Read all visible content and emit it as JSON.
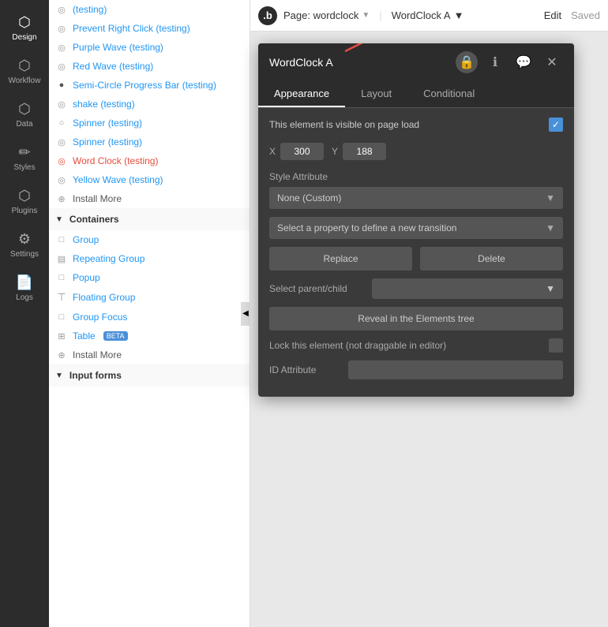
{
  "topbar": {
    "logo": ".b",
    "page_label": "Page: wordclock",
    "wordclock_label": "WordClock A",
    "edit_label": "Edit",
    "saved_label": "Saved"
  },
  "sidebar": {
    "items": [
      {
        "id": "design",
        "label": "Design",
        "icon": "⬡",
        "active": true
      },
      {
        "id": "workflow",
        "label": "Workflow",
        "icon": "⬡"
      },
      {
        "id": "data",
        "label": "Data",
        "icon": "⬡"
      },
      {
        "id": "styles",
        "label": "Styles",
        "icon": "✏"
      },
      {
        "id": "plugins",
        "label": "Plugins",
        "icon": "⬡"
      },
      {
        "id": "settings",
        "label": "Settings",
        "icon": "⚙"
      },
      {
        "id": "logs",
        "label": "Logs",
        "icon": "⬡"
      }
    ]
  },
  "element_list": {
    "items": [
      {
        "id": "testing1",
        "label": "(testing)",
        "icon": "◎",
        "type": "radio"
      },
      {
        "id": "prevent-right",
        "label": "Prevent Right Click (testing)",
        "icon": "◎",
        "type": "radio"
      },
      {
        "id": "purple-wave",
        "label": "Purple Wave (testing)",
        "icon": "◎",
        "type": "radio"
      },
      {
        "id": "red-wave",
        "label": "Red Wave (testing)",
        "icon": "◎",
        "type": "radio"
      },
      {
        "id": "semi-circle",
        "label": "Semi-Circle Progress Bar (testing)",
        "icon": "●",
        "type": "dot"
      },
      {
        "id": "shake",
        "label": "shake (testing)",
        "icon": "◎",
        "type": "radio"
      },
      {
        "id": "spinner1",
        "label": "Spinner (testing)",
        "icon": "○",
        "type": "circle"
      },
      {
        "id": "spinner2",
        "label": "Spinner (testing)",
        "icon": "◎",
        "type": "radio"
      },
      {
        "id": "word-clock",
        "label": "Word Clock (testing)",
        "icon": "◎",
        "type": "radio",
        "highlighted": true
      },
      {
        "id": "yellow-wave",
        "label": "Yellow Wave (testing)",
        "icon": "◎",
        "type": "radio"
      },
      {
        "id": "install-more1",
        "label": "Install More",
        "icon": "⊕",
        "type": "install"
      },
      {
        "id": "containers-header",
        "label": "Containers",
        "icon": "▼",
        "type": "header"
      },
      {
        "id": "group",
        "label": "Group",
        "icon": "□",
        "type": "container"
      },
      {
        "id": "repeating-group",
        "label": "Repeating Group",
        "icon": "▤",
        "type": "container"
      },
      {
        "id": "popup",
        "label": "Popup",
        "icon": "□",
        "type": "container"
      },
      {
        "id": "floating-group",
        "label": "Floating Group",
        "icon": "⊤",
        "type": "container"
      },
      {
        "id": "group-focus",
        "label": "Group Focus",
        "icon": "□",
        "type": "container"
      },
      {
        "id": "table",
        "label": "Table",
        "icon": "⊞",
        "type": "container",
        "badge": "BETA"
      },
      {
        "id": "install-more2",
        "label": "Install More",
        "icon": "⊕",
        "type": "install"
      },
      {
        "id": "input-forms-header",
        "label": "Input forms",
        "icon": "▼",
        "type": "header"
      }
    ]
  },
  "panel": {
    "title": "WordClock A",
    "tabs": [
      "Appearance",
      "Layout",
      "Conditional"
    ],
    "active_tab": "Appearance",
    "visible_label": "This element is visible on page load",
    "x_label": "X",
    "x_value": "300",
    "y_label": "Y",
    "y_value": "188",
    "style_attribute_label": "Style Attribute",
    "style_attribute_value": "None (Custom)",
    "transition_placeholder": "Select a property to define a new transition",
    "replace_label": "Replace",
    "delete_label": "Delete",
    "parent_child_label": "Select parent/child",
    "reveal_label": "Reveal in the Elements tree",
    "lock_label": "Lock this element (not draggable in editor)",
    "id_attribute_label": "ID Attribute"
  }
}
